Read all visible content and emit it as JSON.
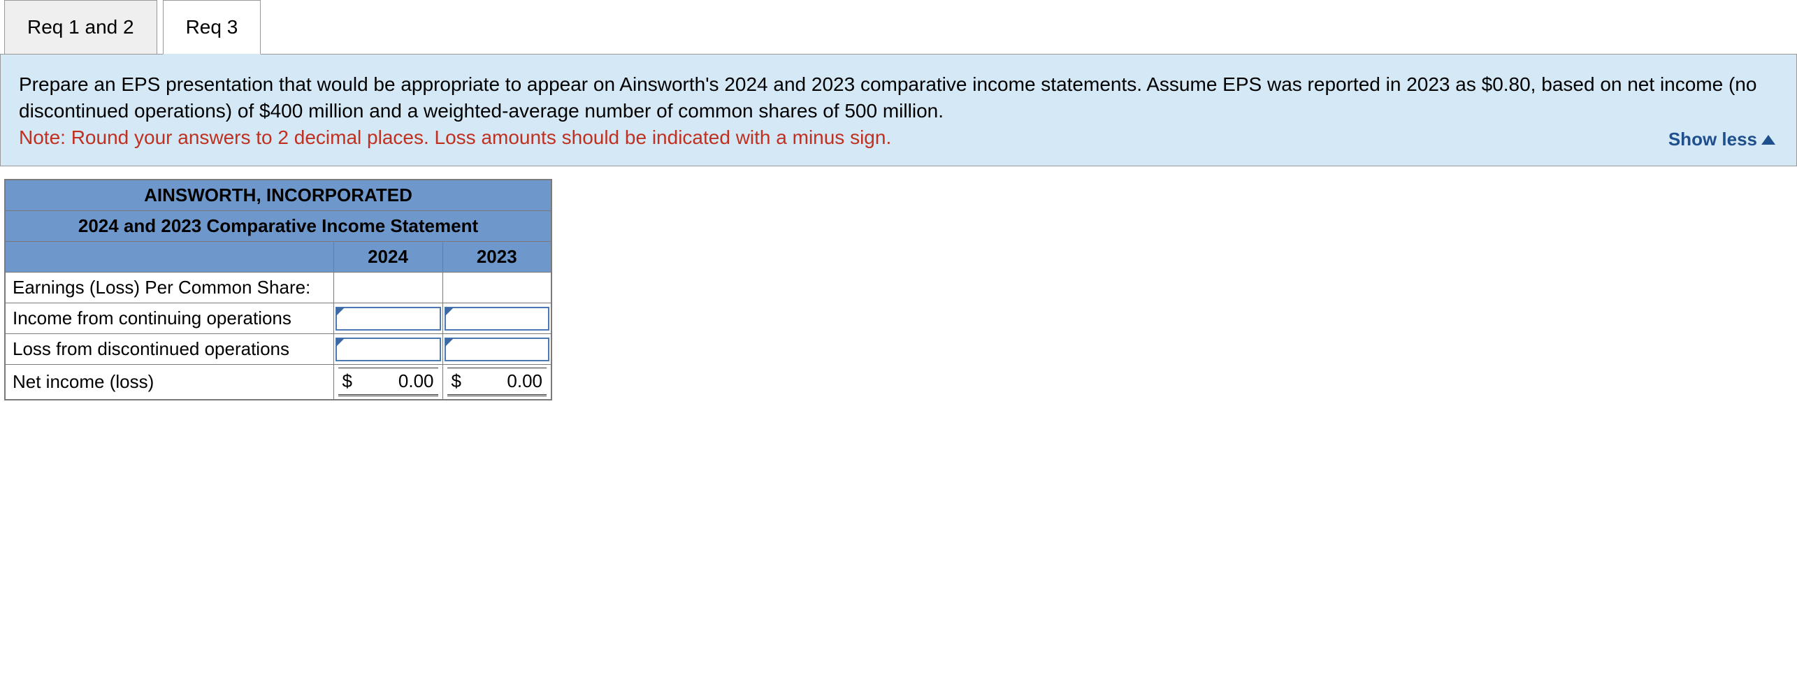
{
  "tabs": {
    "tab1": "Req 1 and 2",
    "tab2": "Req 3"
  },
  "instructions": {
    "body": "Prepare an EPS presentation that would be appropriate to appear on Ainsworth's 2024 and 2023 comparative income statements. Assume EPS was reported in 2023 as $0.80, based on net income (no discontinued operations) of $400 million and a weighted-average number of common shares of 500 million.",
    "note": "Note: Round your answers to 2 decimal places. Loss amounts should be indicated with a minus sign.",
    "toggle": "Show less"
  },
  "table": {
    "company": "AINSWORTH, INCORPORATED",
    "statement_title": "2024 and 2023 Comparative Income Statement",
    "year_headers": {
      "y1": "2024",
      "y2": "2023"
    },
    "rows": {
      "r0": "Earnings (Loss) Per Common Share:",
      "r1": "Income from continuing operations",
      "r2": "Loss from discontinued operations",
      "r3": "Net income (loss)"
    },
    "totals": {
      "currency": "$",
      "y1_value": "0.00",
      "y2_value": "0.00"
    }
  }
}
